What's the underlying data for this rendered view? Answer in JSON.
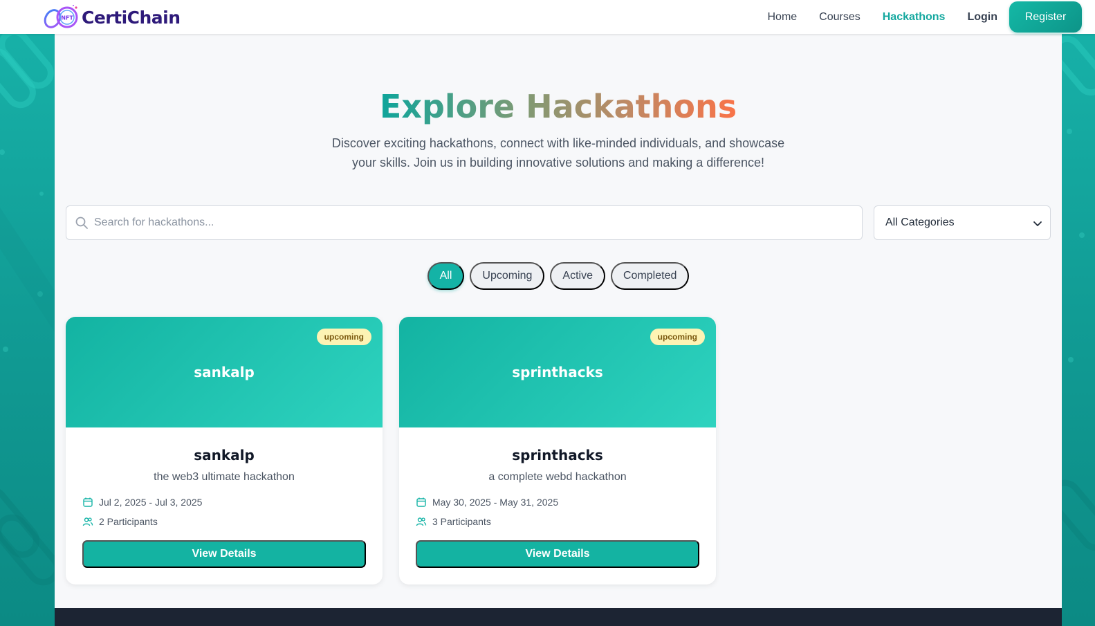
{
  "brand": {
    "name": "CertiChain",
    "badge_text": "NFT"
  },
  "nav": {
    "home": "Home",
    "courses": "Courses",
    "hackathons": "Hackathons",
    "login": "Login",
    "register": "Register"
  },
  "hero": {
    "title": "Explore Hackathons",
    "subtitle_line1": "Discover exciting hackathons, connect with like-minded individuals, and showcase",
    "subtitle_line2": "your skills. Join us in building innovative solutions and making a difference!"
  },
  "search": {
    "placeholder": "Search for hackathons...",
    "value": ""
  },
  "category_select": {
    "selected": "All Categories"
  },
  "filters": [
    "All",
    "Upcoming",
    "Active",
    "Completed"
  ],
  "active_filter": "All",
  "cards": [
    {
      "banner_title": "sankalp",
      "status": "upcoming",
      "title": "sankalp",
      "description": "the web3 ultimate hackathon",
      "dates": "Jul 2, 2025 - Jul 3, 2025",
      "participants": "2 Participants",
      "button": "View Details"
    },
    {
      "banner_title": "sprinthacks",
      "status": "upcoming",
      "title": "sprinthacks",
      "description": "a complete webd hackathon",
      "dates": "May 30, 2025 - May 31, 2025",
      "participants": "3 Participants",
      "button": "View Details"
    }
  ],
  "colors": {
    "accent": "#14b3a6",
    "brand_text": "#2e1a7a",
    "badge_bg": "#fdf3b4",
    "footer": "#1c2433"
  }
}
